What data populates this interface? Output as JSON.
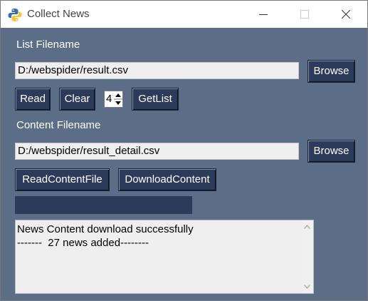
{
  "window": {
    "title": "Collect News"
  },
  "list_section": {
    "label": "List Filename",
    "filename_value": "D:/webspider/result.csv",
    "browse_label": "Browse",
    "read_label": "Read",
    "clear_label": "Clear",
    "spin_value": "4",
    "getlist_label": "GetList"
  },
  "content_section": {
    "label": "Content Filename",
    "filename_value": "D:/webspider/result_detail.csv",
    "browse_label": "Browse",
    "read_content_label": "ReadContentFile",
    "download_label": "DownloadContent"
  },
  "progress": {
    "value": 0
  },
  "log": {
    "lines": [
      "News Content download successfully",
      "-------  27 news added--------"
    ]
  },
  "colors": {
    "window_bg": "#5c6e87",
    "button_bg": "#2b3b59",
    "entry_bg": "#efefef"
  },
  "icons": {
    "app": "python-icon",
    "minimize": "minimize-icon",
    "maximize": "maximize-icon",
    "close": "close-icon"
  }
}
